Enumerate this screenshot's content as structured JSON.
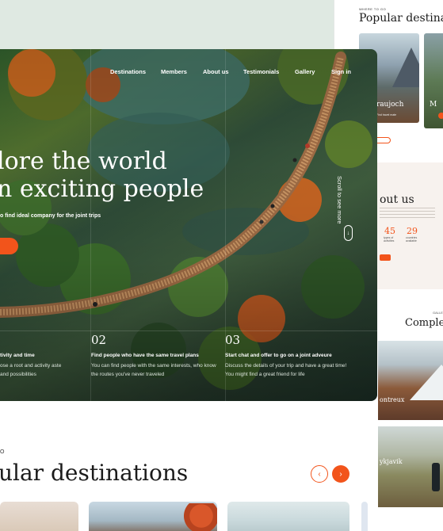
{
  "right_preview": {
    "eyebrow": "WHERE TO GO",
    "title": "Popular destinat",
    "card1_label": "ngfraujoch",
    "card1_sub": "Find travel mate",
    "card2_label": "M",
    "about_eyebrow": "...",
    "about_title": "out us",
    "stat1_value": "45",
    "stat1_label": "types of activities",
    "stat2_value": "29",
    "stat2_label": "countries available",
    "gallery_eyebrow": "GALLE",
    "gallery_title": "Comple",
    "gallery1_label": "ontreux",
    "gallery2_label": "ykjavik"
  },
  "nav": {
    "items": [
      "Destinations",
      "Members",
      "About us",
      "Testimonials",
      "Gallery",
      "Sign in"
    ]
  },
  "hero": {
    "title_line1": "lore the world",
    "title_line2": "n exciting people",
    "subtitle": "o find ideal company for the joint trips",
    "scroll_label": "Scroll to see more",
    "scroll_icon": "↓"
  },
  "steps": [
    {
      "number": "",
      "title": "tivity and time",
      "desc": "ose a root and activity aste and possibilities"
    },
    {
      "number": "02",
      "title": "Find people who have the same travel plans",
      "desc": "You can find people with the same interests, who know the routes you've never traveled"
    },
    {
      "number": "03",
      "title": "Start chat and offer to go on a joint adveure",
      "desc": "Discuss the details of your trip and have a great time! You might find a great friend for life"
    }
  ],
  "popular": {
    "eyebrow": "O",
    "title": "ular destinations",
    "prev_icon": "‹",
    "next_icon": "›"
  },
  "colors": {
    "accent": "#f2541b",
    "text_dark": "#1b1b1b"
  }
}
